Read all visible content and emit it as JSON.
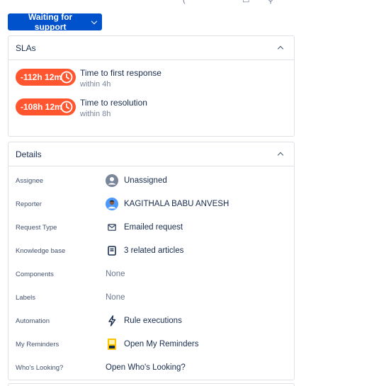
{
  "status": {
    "label": "Waiting for support"
  },
  "sla": {
    "title": "SLAs",
    "items": [
      {
        "time": "-112h 12m",
        "name": "Time to first response",
        "target": "within 4h"
      },
      {
        "time": "-108h 12m",
        "name": "Time to resolution",
        "target": "within 8h"
      }
    ],
    "pill_color": "#ff5630"
  },
  "details": {
    "title": "Details",
    "rows": [
      {
        "label": "Assignee",
        "value": "Unassigned",
        "icon": "avatar-placeholder-icon"
      },
      {
        "label": "Reporter",
        "value": "KAGITHALA BABU ANVESH",
        "icon": "user-avatar"
      },
      {
        "label": "Request Type",
        "value": "Emailed request",
        "icon": "email-icon"
      },
      {
        "label": "Knowledge base",
        "value": "3 related articles",
        "icon": "book-icon"
      },
      {
        "label": "Components",
        "value": "None"
      },
      {
        "label": "Labels",
        "value": "None"
      },
      {
        "label": "Automation",
        "value": "Rule executions",
        "icon": "lightning-icon"
      },
      {
        "label": "My Reminders",
        "value": "Open My Reminders",
        "icon": "reminders-app-icon"
      },
      {
        "label": "Who's Looking?",
        "value": "Open Who's Looking?"
      }
    ]
  },
  "colors": {
    "primary": "#0052cc",
    "breached": "#ff5630",
    "border": "#dfe1e6"
  }
}
